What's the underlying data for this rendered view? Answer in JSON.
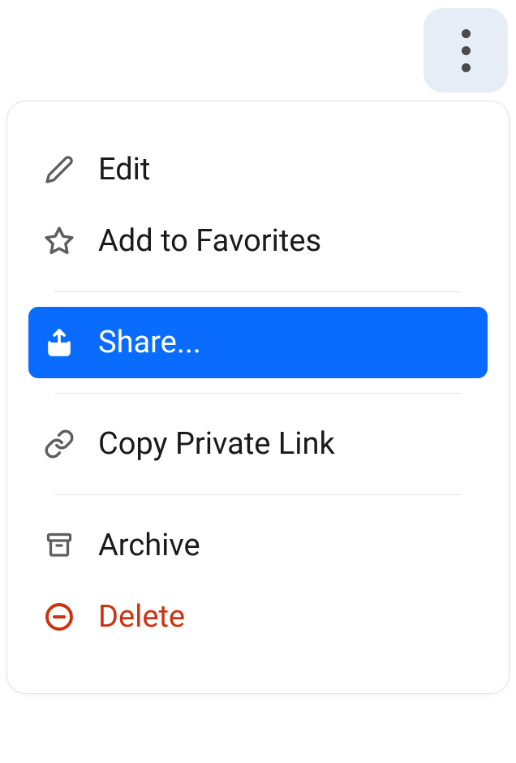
{
  "menu": {
    "edit": "Edit",
    "favorites": "Add to Favorites",
    "share": "Share...",
    "copyLink": "Copy Private Link",
    "archive": "Archive",
    "delete": "Delete"
  },
  "colors": {
    "selected": "#0a6cff",
    "danger": "#cc3311",
    "iconGray": "#5e5e5e"
  }
}
